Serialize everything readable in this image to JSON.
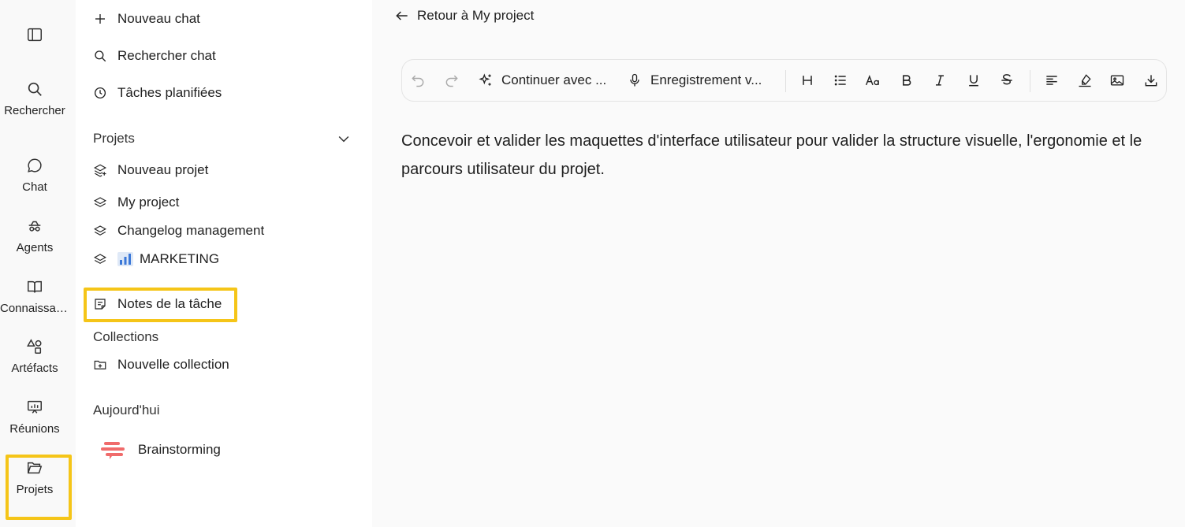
{
  "rail": {
    "items": [
      {
        "label": "Rechercher",
        "icon": "search-icon"
      },
      {
        "label": "Chat",
        "icon": "chat-bubble-icon"
      },
      {
        "label": "Agents",
        "icon": "agents-icon"
      },
      {
        "label": "Connaissanc...",
        "icon": "book-icon"
      },
      {
        "label": "Artéfacts",
        "icon": "shapes-icon"
      },
      {
        "label": "Réunions",
        "icon": "presentation-icon"
      },
      {
        "label": "Projets",
        "icon": "folder-open-icon"
      }
    ],
    "highlight_color": "#f5c518"
  },
  "sidebar": {
    "top": [
      {
        "label": "Nouveau chat",
        "icon": "plus-icon"
      },
      {
        "label": "Rechercher chat",
        "icon": "search-icon"
      },
      {
        "label": "Tâches planifiées",
        "icon": "clock-icon"
      }
    ],
    "projects_heading": "Projets",
    "projects": [
      {
        "label": "Nouveau projet",
        "icon": "layers-plus-icon"
      },
      {
        "label": "My project",
        "icon": "layers-icon"
      },
      {
        "label": "Changelog management",
        "icon": "layers-icon"
      },
      {
        "label": "MARKETING",
        "icon": "layers-icon"
      }
    ],
    "notes": {
      "label": "Notes de la tâche",
      "icon": "note-icon"
    },
    "collections_heading": "Collections",
    "new_collection": {
      "label": "Nouvelle collection",
      "icon": "folder-plus-icon"
    },
    "today_heading": "Aujourd'hui",
    "today": [
      {
        "label": "Brainstorming",
        "icon": "brainstorm-icon"
      }
    ]
  },
  "main": {
    "back_label": "Retour à My project",
    "toolbar": {
      "continue_label": "Continuer avec ...",
      "record_label": "Enregistrement v..."
    },
    "content": "Concevoir et valider les maquettes d'interface utilisateur pour valider la structure visuelle, l'ergonomie et le parcours utilisateur du projet."
  }
}
